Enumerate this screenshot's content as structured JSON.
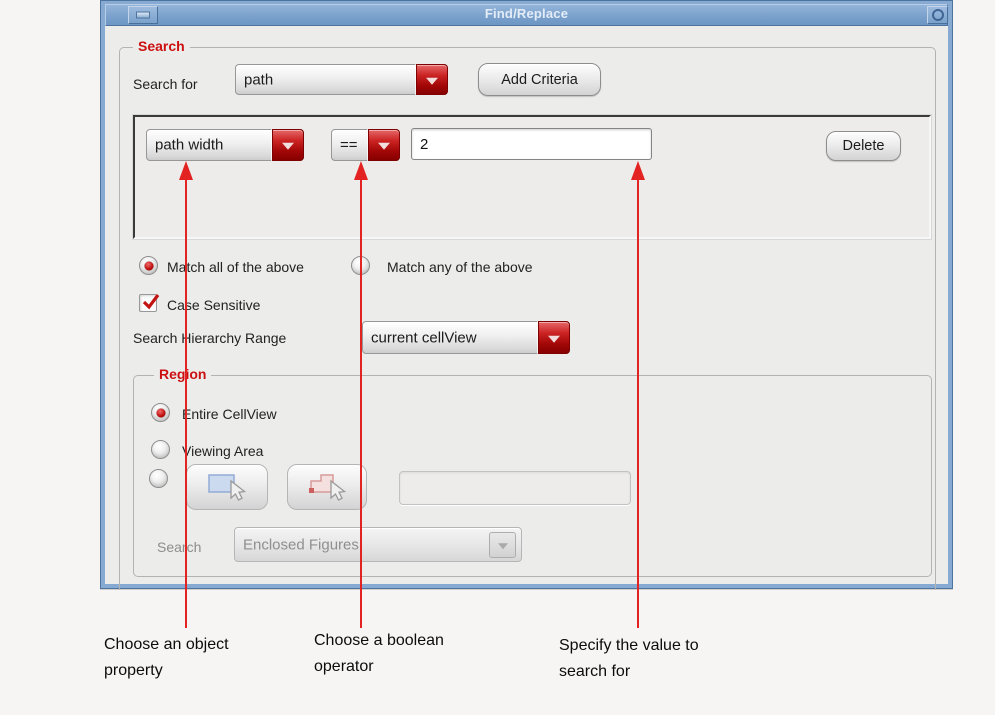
{
  "titlebar": {
    "title": "Find/Replace"
  },
  "search": {
    "group_label": "Search",
    "search_for_label": "Search for",
    "object_type_value": "path",
    "add_criteria_label": "Add Criteria",
    "criteria": {
      "property_value": "path width",
      "operator_value": "==",
      "value": "2",
      "delete_label": "Delete"
    },
    "match_all_label": "Match all of the above",
    "match_any_label": "Match any of the above",
    "case_sensitive_label": "Case Sensitive",
    "hierarchy_label": "Search Hierarchy Range",
    "hierarchy_value": "current cellView"
  },
  "region": {
    "group_label": "Region",
    "entire_cellview_label": "Entire CellView",
    "viewing_area_label": "Viewing Area",
    "search_label": "Search",
    "search_mode_value": "Enclosed Figures"
  },
  "annotations": {
    "property": "Choose an object property",
    "operator": "Choose a boolean operator",
    "value": "Specify the value to search for"
  },
  "state": {
    "match_mode_selected": "Match all of the above",
    "case_sensitive_checked": true,
    "region_selected": "Entire CellView"
  },
  "colors": {
    "accent_red": "#cc1111",
    "titlebar_blue": "#7ba2cc",
    "dialog_bg": "#ececea",
    "annotation_red": "#e32222"
  }
}
